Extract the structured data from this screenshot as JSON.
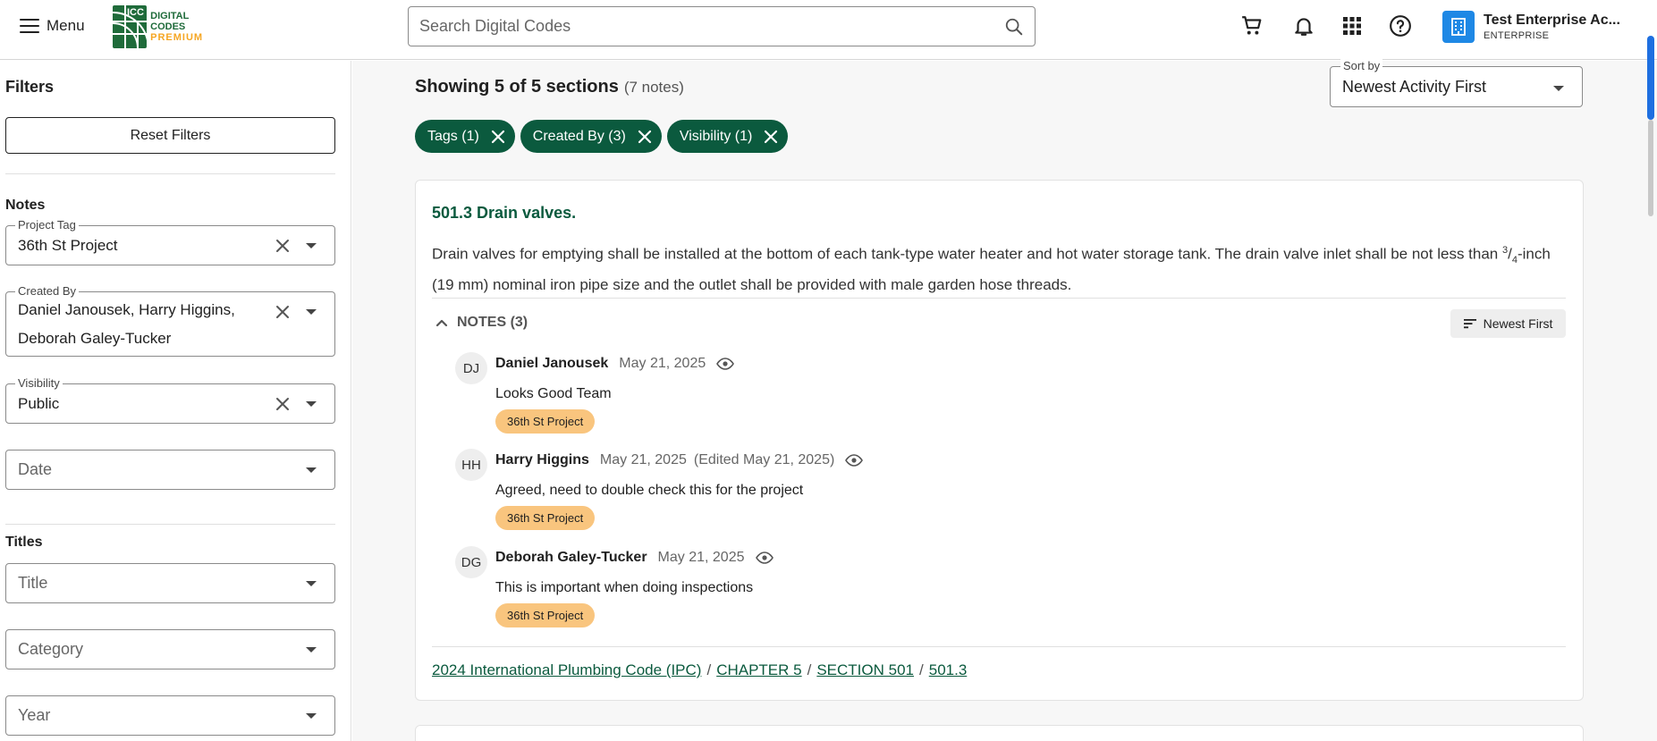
{
  "header": {
    "menu_label": "Menu",
    "logo": {
      "mark_text": "ICC",
      "line1": "DIGITAL CODES",
      "line2": "PREMIUM"
    },
    "search_placeholder": "Search Digital Codes",
    "icons": [
      "cart-icon",
      "bell-icon",
      "apps-grid-icon",
      "help-icon"
    ],
    "account": {
      "name": "Test Enterprise Ac...",
      "type": "ENTERPRISE",
      "icon": "building-icon",
      "color": "#1e88e5"
    }
  },
  "sidebar": {
    "title": "Filters",
    "reset_label": "Reset Filters",
    "notes_section": "Notes",
    "project_tag": {
      "label": "Project Tag",
      "value": "36th St Project"
    },
    "created_by": {
      "label": "Created By",
      "value_line1": "Daniel Janousek, Harry Higgins,",
      "value_line2": "Deborah Galey-Tucker"
    },
    "visibility": {
      "label": "Visibility",
      "value": "Public"
    },
    "date_placeholder": "Date",
    "titles_section": "Titles",
    "title_placeholder": "Title",
    "category_placeholder": "Category",
    "year_placeholder": "Year"
  },
  "main": {
    "showing": "Showing 5 of 5 sections",
    "notes_count": "(7 notes)",
    "sort": {
      "label": "Sort by",
      "value": "Newest Activity First"
    },
    "chips": [
      {
        "label": "Tags (1)"
      },
      {
        "label": "Created By (3)"
      },
      {
        "label": "Visibility (1)"
      }
    ],
    "section": {
      "title": "501.3 Drain valves.",
      "body_part1": "Drain valves for emptying shall be installed at the bottom of each tank-type water heater and hot water storage tank. The drain valve inlet shall be not less than ",
      "frac_num": "3",
      "frac_sep": "/",
      "frac_den": "4",
      "body_part2": "-inch (19 mm) nominal iron pipe size and the outlet shall be provided with male garden hose threads.",
      "notes_header": "NOTES (3)",
      "newest_label": "Newest First",
      "notes": [
        {
          "initials": "DJ",
          "author": "Daniel Janousek",
          "date": "May 21, 2025",
          "edited": "",
          "text": "Looks Good Team",
          "tag": "36th St Project"
        },
        {
          "initials": "HH",
          "author": "Harry Higgins",
          "date": "May 21, 2025",
          "edited": "(Edited May 21, 2025)",
          "text": "Agreed, need to double check this for the project",
          "tag": "36th St Project"
        },
        {
          "initials": "DG",
          "author": "Deborah Galey-Tucker",
          "date": "May 21, 2025",
          "edited": "",
          "text": "This is important when doing inspections",
          "tag": "36th St Project"
        }
      ],
      "breadcrumb": [
        "2024 International Plumbing Code (IPC)",
        "CHAPTER 5",
        "SECTION 501",
        "501.3"
      ],
      "breadcrumb_sep": "/"
    }
  },
  "colors": {
    "brand_green": "#0b5a3e",
    "tag_orange": "#f9c57e",
    "accent_blue": "#1e88e5"
  }
}
